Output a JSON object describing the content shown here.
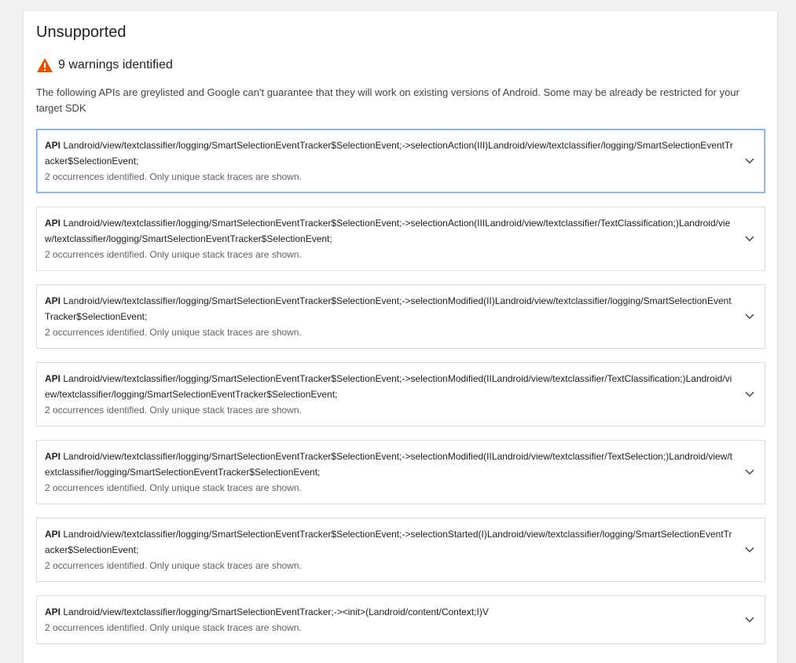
{
  "section": {
    "title": "Unsupported"
  },
  "warning": {
    "icon": "warning-triangle-icon",
    "color": "#e65100",
    "count_text": "9 warnings identified"
  },
  "description": "The following APIs are greylisted and Google can't guarantee that they will work on existing versions of Android. Some may be already be restricted for your target SDK",
  "api_prefix": "API",
  "items": [
    {
      "signature": "Landroid/view/textclassifier/logging/SmartSelectionEventTracker$SelectionEvent;->selectionAction(III)Landroid/view/textclassifier/logging/SmartSelectionEventTracker$SelectionEvent;",
      "occurrences": "2 occurrences identified. Only unique stack traces are shown."
    },
    {
      "signature": "Landroid/view/textclassifier/logging/SmartSelectionEventTracker$SelectionEvent;->selectionAction(IIILandroid/view/textclassifier/TextClassification;)Landroid/view/textclassifier/logging/SmartSelectionEventTracker$SelectionEvent;",
      "occurrences": "2 occurrences identified. Only unique stack traces are shown."
    },
    {
      "signature": "Landroid/view/textclassifier/logging/SmartSelectionEventTracker$SelectionEvent;->selectionModified(II)Landroid/view/textclassifier/logging/SmartSelectionEventTracker$SelectionEvent;",
      "occurrences": "2 occurrences identified. Only unique stack traces are shown."
    },
    {
      "signature": "Landroid/view/textclassifier/logging/SmartSelectionEventTracker$SelectionEvent;->selectionModified(IILandroid/view/textclassifier/TextClassification;)Landroid/view/textclassifier/logging/SmartSelectionEventTracker$SelectionEvent;",
      "occurrences": "2 occurrences identified. Only unique stack traces are shown."
    },
    {
      "signature": "Landroid/view/textclassifier/logging/SmartSelectionEventTracker$SelectionEvent;->selectionModified(IILandroid/view/textclassifier/TextSelection;)Landroid/view/textclassifier/logging/SmartSelectionEventTracker$SelectionEvent;",
      "occurrences": "2 occurrences identified. Only unique stack traces are shown."
    },
    {
      "signature": "Landroid/view/textclassifier/logging/SmartSelectionEventTracker$SelectionEvent;->selectionStarted(I)Landroid/view/textclassifier/logging/SmartSelectionEventTracker$SelectionEvent;",
      "occurrences": "2 occurrences identified. Only unique stack traces are shown."
    },
    {
      "signature": "Landroid/view/textclassifier/logging/SmartSelectionEventTracker;-><init>(Landroid/content/Context;I)V",
      "occurrences": "2 occurrences identified. Only unique stack traces are shown."
    }
  ],
  "expand_icon": "chevron-down-icon"
}
